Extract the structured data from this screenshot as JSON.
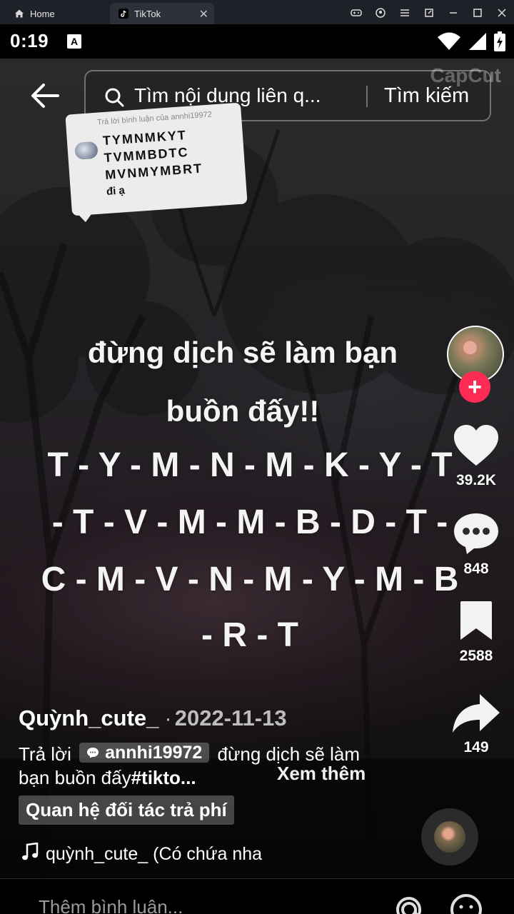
{
  "emulator": {
    "tab_home": "Home",
    "tab_app": "TikTok"
  },
  "status_bar": {
    "time": "0:19",
    "notification_badge": "A"
  },
  "watermark": "CapCut",
  "search": {
    "query": "Tìm nội dung liên q...",
    "button_label": "Tìm kiếm"
  },
  "reply_sticker": {
    "header": "Trả lời bình luận của annhi19972",
    "line1": "TYMNMKYT",
    "line2": "TVMMBDTC",
    "line3": "MVNMYMBRT",
    "line4": "đi ạ"
  },
  "caption": {
    "line1": "đừng dịch sẽ làm bạn",
    "line2": "buồn đấy!!",
    "line3": "T - Y - M - N - M - K - Y - T",
    "line4": "- T - V - M - M - B - D - T -",
    "line5": "C - M - V - N - M - Y - M - B",
    "line6": "- R - T"
  },
  "actions": {
    "likes": "39.2K",
    "comments": "848",
    "saves": "2588",
    "shares": "149"
  },
  "post": {
    "author": "Quỳnh_cute_",
    "separator": "·",
    "date": "2022-11-13",
    "reply_prefix": "Trả lời",
    "reply_user": "annhi19972",
    "desc_text": " đừng dịch sẽ làm bạn buồn đấy",
    "hashtag": "#tikto...",
    "see_more": "Xem thêm",
    "partner_label": "Quan hệ đối tác trả phí",
    "music": "quỳnh_cute_ (Có chứa nha"
  },
  "comment_bar": {
    "placeholder": "Thêm bình luận..."
  },
  "colors": {
    "follow_accent": "#fe2c55",
    "emulator_bar": "#1f2129"
  }
}
